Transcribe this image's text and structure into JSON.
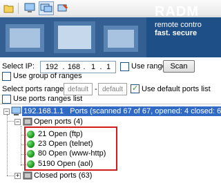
{
  "toolbar": {
    "icons": [
      "open-folder-icon",
      "network-scan-icon",
      "remote-control-icon",
      "tools-icon"
    ]
  },
  "banner": {
    "title": "RADM",
    "subtitle": "remote contro",
    "tagline": "fast. secure"
  },
  "scan": {
    "select_ip_label": "Select IP:",
    "ip": [
      "192",
      "168",
      "1",
      "1"
    ],
    "use_range_label": "Use range",
    "scan_button": "Scan",
    "use_group_label": "Use group of ranges",
    "ports_range_label": "Select ports range:",
    "port_from_placeholder": "default",
    "port_to_placeholder": "default",
    "use_default_ports_label": "Use default ports list",
    "use_ports_ranges_label": "Use ports ranges list",
    "use_range_checked": false,
    "use_group_checked": false,
    "use_default_ports_checked": true,
    "use_ports_ranges_checked": false
  },
  "tree": {
    "host": "192.168.1.1",
    "host_summary": "Ports (scanned 67 of 67, opened: 4 closed: 63)",
    "open_ports_label": "Open ports (4)",
    "open_ports": [
      "21 Open (ftp)",
      "23 Open (telnet)",
      "80 Open (www-http)",
      "5190 Open (aol)"
    ],
    "closed_ports_label": "Closed ports (63)"
  }
}
